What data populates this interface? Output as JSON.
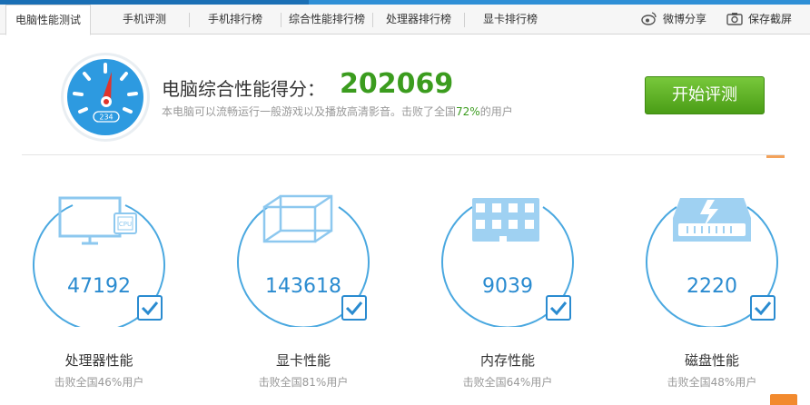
{
  "tabs": [
    {
      "label": "电脑性能测试",
      "active": true
    },
    {
      "label": "手机评测"
    },
    {
      "label": "手机排行榜"
    },
    {
      "label": "综合性能排行榜"
    },
    {
      "label": "处理器排行榜"
    },
    {
      "label": "显卡排行榜"
    }
  ],
  "share": {
    "weibo_label": "微博分享",
    "screenshot_label": "保存截屏"
  },
  "score": {
    "title": "电脑综合性能得分：",
    "value": "202069",
    "desc_prefix": "本电脑可以流畅运行一般游戏以及播放高清影音。击败了全国",
    "desc_pct": "72%",
    "desc_suffix": "的用户"
  },
  "gauge": {
    "display_text": "234"
  },
  "start_button": {
    "label": "开始评测"
  },
  "cards": [
    {
      "value": "47192",
      "name": "处理器性能",
      "sub": "击败全国46%用户",
      "icon": "monitor-cpu-icon",
      "checked": true
    },
    {
      "value": "143618",
      "name": "显卡性能",
      "sub": "击败全国81%用户",
      "icon": "gpu-cube-icon",
      "checked": true
    },
    {
      "value": "9039",
      "name": "内存性能",
      "sub": "击败全国64%用户",
      "icon": "memory-chip-icon",
      "checked": true
    },
    {
      "value": "2220",
      "name": "磁盘性能",
      "sub": "击败全国48%用户",
      "icon": "disk-drive-icon",
      "checked": true
    }
  ],
  "colors": {
    "accent_blue": "#2a8bd0",
    "score_green": "#3b9c1e",
    "button_green": "#5aaf21",
    "ring_blue": "#4aa8e0"
  }
}
